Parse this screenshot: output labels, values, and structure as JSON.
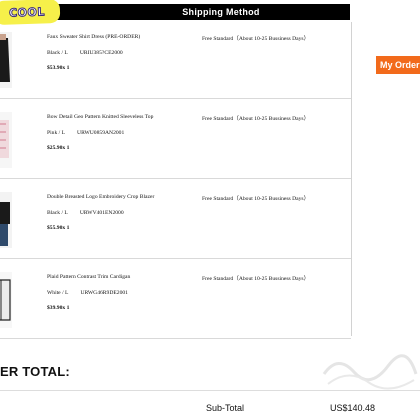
{
  "logo": {
    "text": "COOL"
  },
  "header": {
    "title": "Shipping Method"
  },
  "items": [
    {
      "name": "Faux Sweater Shirt Dress (PRE-ORDER)",
      "variant": "Black / L",
      "sku": "URIU385?CE2000",
      "price": "$53.90x 1",
      "shipping": "Free Standard（About 10-25 Bussiness Days）",
      "color": "#1a1a1a"
    },
    {
      "name": "Bow Detail Geo Pattern Knitted Sleeveless Top",
      "variant": "Pink / L",
      "sku": "URWU0859AN2001",
      "price": "$25.90x 1",
      "shipping": "Free Standard（About 10-25 Bussiness Days）",
      "color": "#e8b7c0"
    },
    {
      "name": "Double Breasted Logo Embroidery Crop Blazer",
      "variant": "Black / L",
      "sku": "URWV401EN2000",
      "price": "$55.90x 1",
      "shipping": "Free Standard（About 10-25 Bussiness Days）",
      "color": "#1a1a1a"
    },
    {
      "name": "Plaid Pattern Contrast Trim Cardigan",
      "variant": "White / L",
      "sku": "URWG46R9DE2001",
      "price": "$39.90x 1",
      "shipping": "Free Standard（About 10-25 Bussiness Days）",
      "color": "#e9e9e9"
    }
  ],
  "order_button": {
    "label": "My Order"
  },
  "totals": {
    "title": "ER TOTAL:",
    "subtotal_label": "Sub-Total",
    "subtotal_value": "US$140.48"
  },
  "colors": {
    "accent": "#f26a1b",
    "header_bg": "#000000",
    "logo_bg": "#f6f04a"
  }
}
